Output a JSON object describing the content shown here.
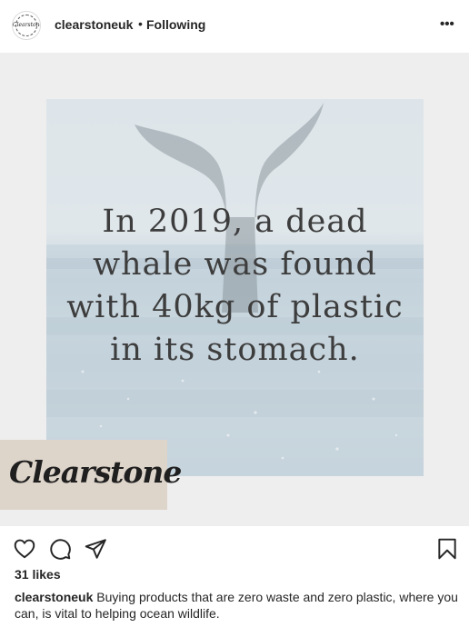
{
  "header": {
    "username": "clearstoneuk",
    "separator": "•",
    "follow_status": "Following",
    "more_label": "•••",
    "avatar_text": "Clearstone"
  },
  "post": {
    "overlay_lines": [
      "In 2019, a dead",
      "whale was found",
      "with 40kg of plastic",
      "in its stomach."
    ],
    "brand": "Clearstone",
    "colors": {
      "background": "#efeeee",
      "brand_box": "#ddd4ca",
      "text": "#3d3d3d"
    }
  },
  "actions": {
    "icons": [
      "heart-icon",
      "comment-icon",
      "share-icon",
      "bookmark-icon"
    ]
  },
  "likes": "31 likes",
  "caption": {
    "user": "clearstoneuk",
    "text": "Buying products that are zero waste and zero plastic, where you can, is vital to helping ocean wildlife."
  }
}
